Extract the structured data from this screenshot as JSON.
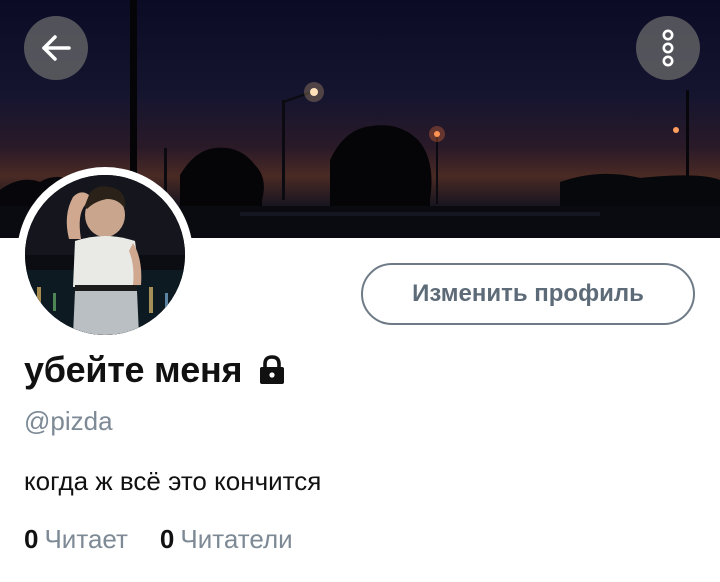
{
  "header": {
    "back_icon": "arrow-left-icon",
    "more_icon": "vertical-dots-icon"
  },
  "profile": {
    "display_name": "убейте меня",
    "lock_icon": "lock-icon",
    "handle": "@pizda",
    "bio": "когда ж всё это кончится",
    "edit_button_label": "Изменить профиль"
  },
  "stats": {
    "following_count": "0",
    "following_label": "Читает",
    "followers_count": "0",
    "followers_label": "Читатели"
  },
  "colors": {
    "button_overlay": "#6e6e6e",
    "secondary_text": "#7d8a96",
    "outline": "#6e7b87"
  }
}
